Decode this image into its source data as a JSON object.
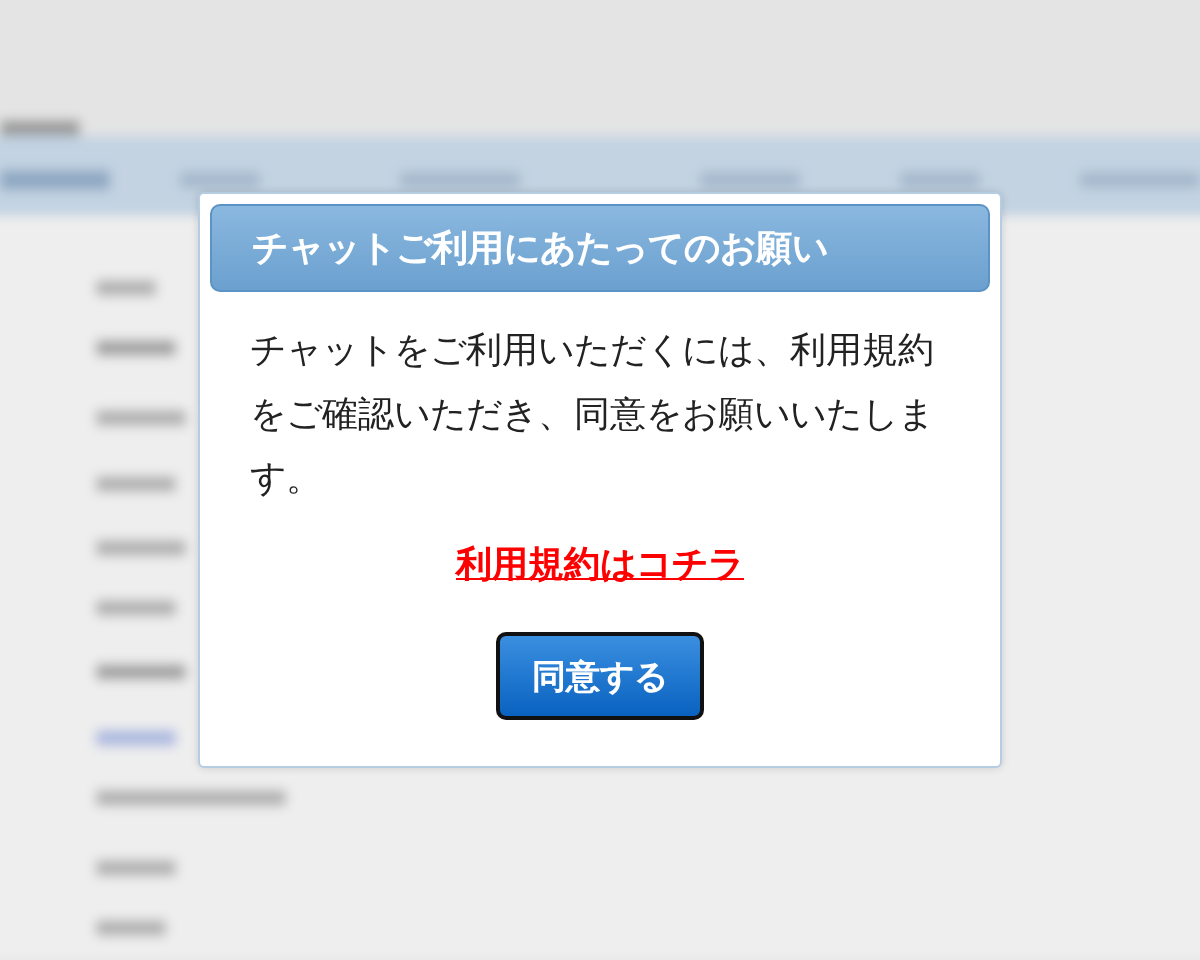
{
  "dialog": {
    "title": "チャットご利用にあたってのお願い",
    "message": "チャットをご利用いただくには、利用規約をご確認いただき、同意をお願いいたします。",
    "terms_link": "利用規約はコチラ",
    "agree_button": "同意する"
  }
}
